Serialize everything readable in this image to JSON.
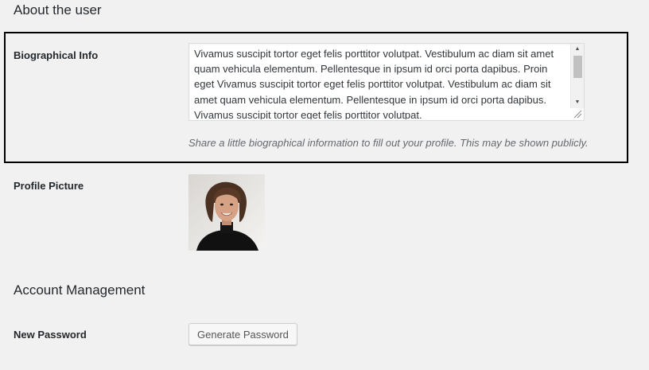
{
  "sections": {
    "about_title": "About the user",
    "account_title": "Account Management"
  },
  "bio": {
    "label": "Biographical Info",
    "text": "Vivamus suscipit tortor eget felis porttitor volutpat. Vestibulum ac diam sit amet quam vehicula elementum. Pellentesque in ipsum id orci porta dapibus. Proin eget Vivamus suscipit tortor eget felis porttitor volutpat. Vestibulum ac diam sit amet quam vehicula elementum. Pellentesque in ipsum id orci porta dapibus. Vivamus suscipit tortor eget felis porttitor volutpat.",
    "description": "Share a little biographical information to fill out your profile. This may be shown publicly."
  },
  "picture": {
    "label": "Profile Picture",
    "icon": "user-avatar-photo"
  },
  "password": {
    "label": "New Password",
    "button_label": "Generate Password"
  },
  "colors": {
    "background": "#f1f1f1",
    "highlight_border": "#000000",
    "description_text": "#646970"
  }
}
